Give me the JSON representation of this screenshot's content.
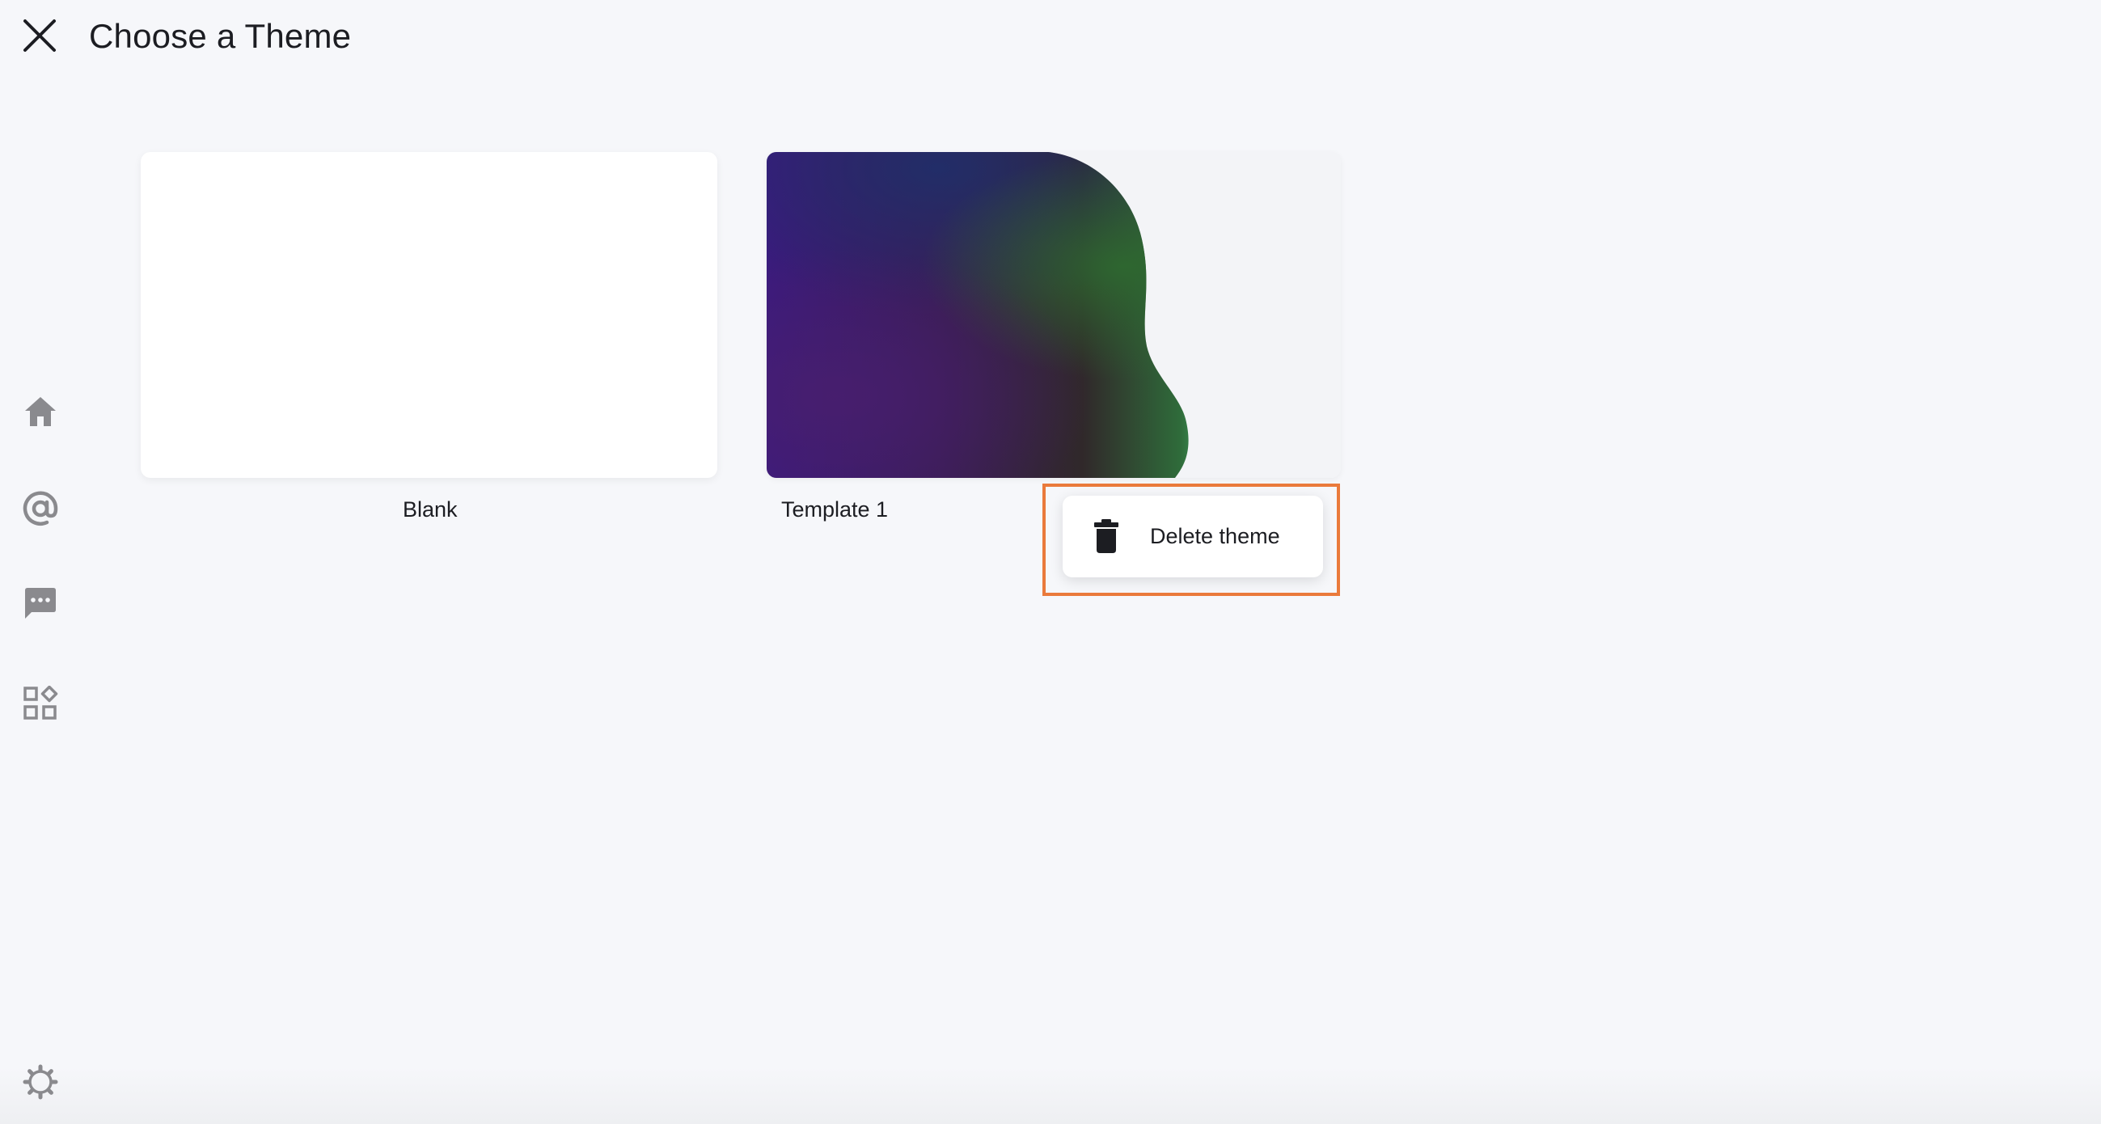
{
  "header": {
    "title": "Choose a Theme",
    "close_icon": "close-icon"
  },
  "sidebar": {
    "items": [
      {
        "name": "home",
        "icon": "home-icon"
      },
      {
        "name": "mentions",
        "icon": "at-icon"
      },
      {
        "name": "messages",
        "icon": "chat-icon"
      },
      {
        "name": "apps",
        "icon": "apps-grid-icon"
      }
    ],
    "settings_icon": "gear-icon"
  },
  "themes": [
    {
      "label": "Blank"
    },
    {
      "label": "Template 1"
    }
  ],
  "context_menu": {
    "items": [
      {
        "label": "Delete theme",
        "icon": "trash-icon"
      }
    ]
  },
  "colors": {
    "background": "#f6f7fa",
    "text": "#1c1d22",
    "icon_gray": "#8a8a8e",
    "highlight_frame": "#ea7a3b"
  }
}
